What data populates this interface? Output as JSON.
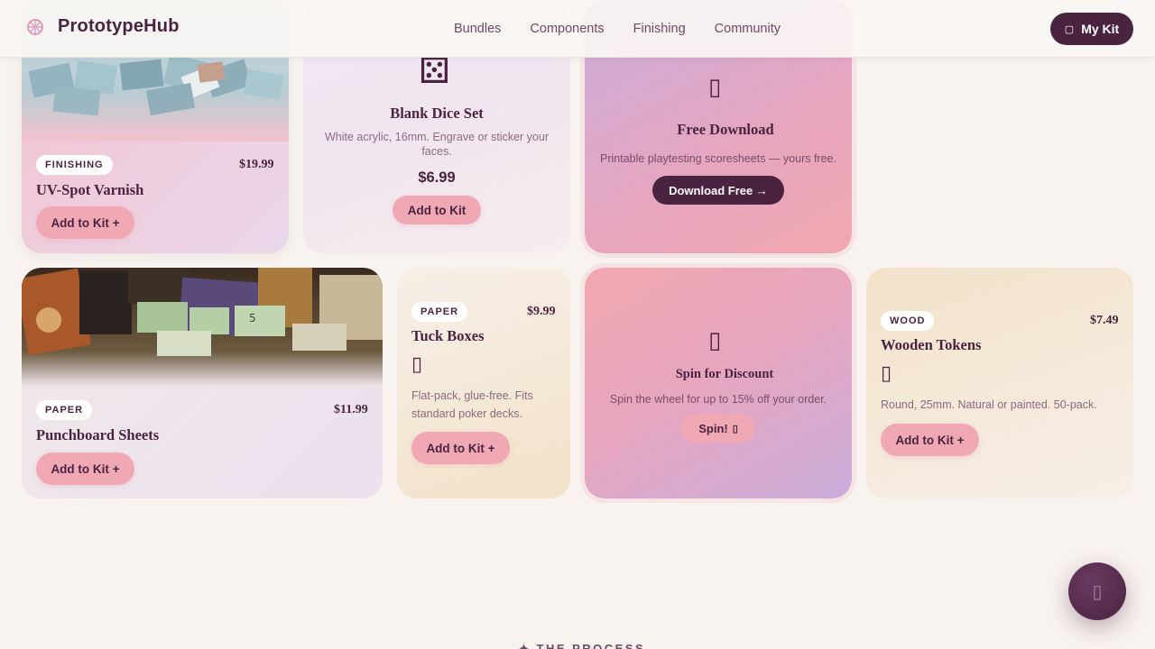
{
  "brand": {
    "name": "PrototypeHub"
  },
  "nav": {
    "links": [
      "Bundles",
      "Components",
      "Finishing",
      "Community"
    ],
    "kit_button": "My Kit",
    "kit_icon": "bag-icon"
  },
  "cards": {
    "uv": {
      "tag": "FINISHING",
      "price": "$19.99",
      "title": "UV-Spot Varnish",
      "button": "Add to Kit +"
    },
    "dice": {
      "icon": "⚄",
      "title": "Blank Dice Set",
      "desc": "White acrylic, 16mm. Engrave or sticker your faces.",
      "price": "$6.99",
      "button": "Add to Kit"
    },
    "download": {
      "icon": "document-icon",
      "title": "Free Download",
      "desc": "Printable playtesting scoresheets — yours free.",
      "button": "Download Free →"
    },
    "punch": {
      "tag": "PAPER",
      "price": "$11.99",
      "title": "Punchboard Sheets",
      "button": "Add to Kit +"
    },
    "tuck": {
      "tag": "PAPER",
      "price": "$9.99",
      "title": "Tuck Boxes",
      "icon": "box-icon",
      "desc": "Flat-pack, glue-free. Fits standard poker decks.",
      "button": "Add to Kit +"
    },
    "spin": {
      "icon": "wheel-icon",
      "title": "Spin for Discount",
      "desc": "Spin the wheel for up to 15% off your order.",
      "button": "Spin!"
    },
    "wood": {
      "tag": "WOOD",
      "price": "$7.49",
      "title": "Wooden Tokens",
      "icon": "token-icon",
      "desc": "Round, 25mm. Natural or painted. 50-pack.",
      "button": "Add to Kit +"
    }
  },
  "fab": {
    "icon": "chat-icon"
  },
  "section": {
    "label": "✦ THE PROCESS"
  },
  "colors": {
    "brand": "#4a2340",
    "accent": "#f0a9b4",
    "background": "#f8f3ef"
  }
}
